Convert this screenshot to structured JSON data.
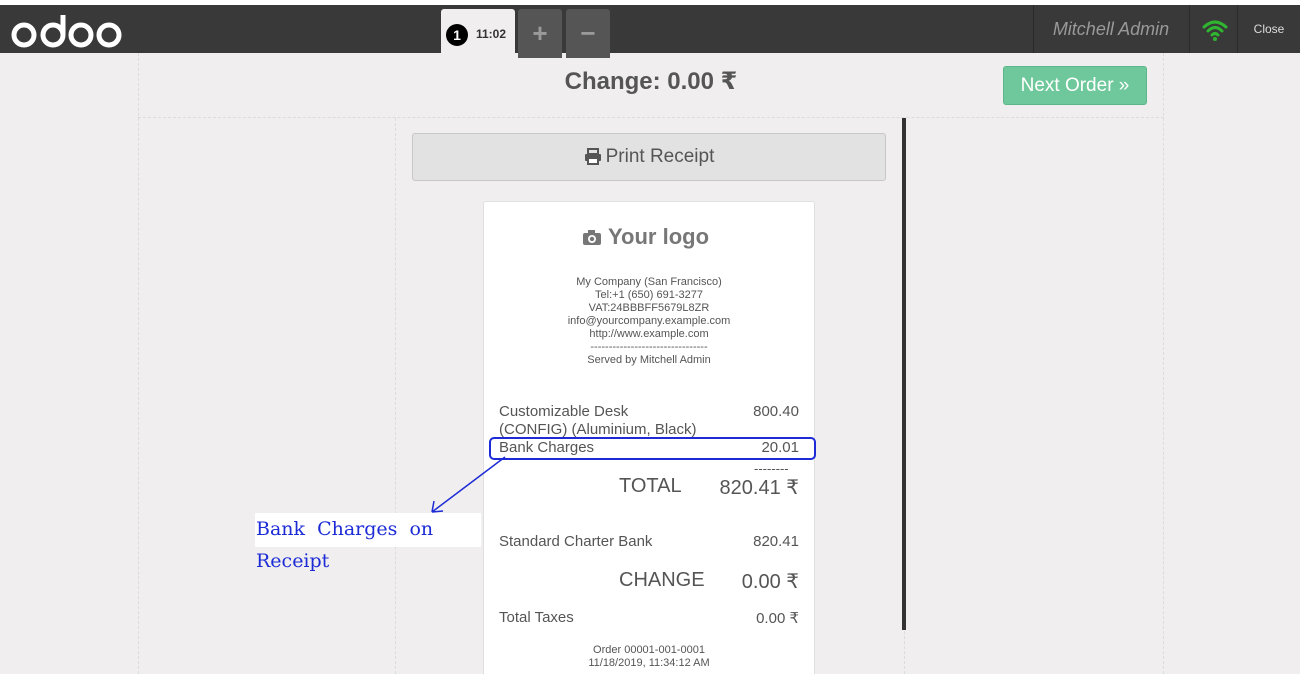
{
  "topbar": {
    "logo_text": "odoo",
    "order_number": "1",
    "order_time": "11:02",
    "add_label": "+",
    "remove_label": "−",
    "user_name": "Mitchell Admin",
    "close_label": "Close",
    "wifi_color": "#2fb52f"
  },
  "screen": {
    "change_title": "Change: 0.00 ₹",
    "next_order_label": "Next Order »",
    "print_label": "Print Receipt"
  },
  "receipt": {
    "logo_text": "Your logo",
    "company": [
      "My Company (San Francisco)",
      "Tel:+1 (650) 691-3277",
      "VAT:24BBBFF5679L8ZR",
      "info@yourcompany.example.com",
      "http://www.example.com",
      "--------------------------------",
      "Served by Mitchell Admin"
    ],
    "lines": [
      {
        "name": "Customizable Desk",
        "name2": "(CONFIG) (Aluminium, Black)",
        "amount": "800.40"
      },
      {
        "name": "Bank Charges",
        "amount": "20.01"
      }
    ],
    "dashes": "--------",
    "total_label": "TOTAL",
    "total_value": "820.41 ₹",
    "payment_name": "Standard Charter Bank",
    "payment_value": "820.41",
    "change_label": "CHANGE",
    "change_value": "0.00 ₹",
    "taxes_label": "Total Taxes",
    "taxes_value": "0.00 ₹",
    "order_ref": "Order 00001-001-0001",
    "order_date": "11/18/2019, 11:34:12 AM"
  },
  "annotation": {
    "label": "Bank Charges on Receipt",
    "color": "#1c2bd6"
  },
  "colors": {
    "topbar": "#393939",
    "next_order": "#6ec89b"
  }
}
